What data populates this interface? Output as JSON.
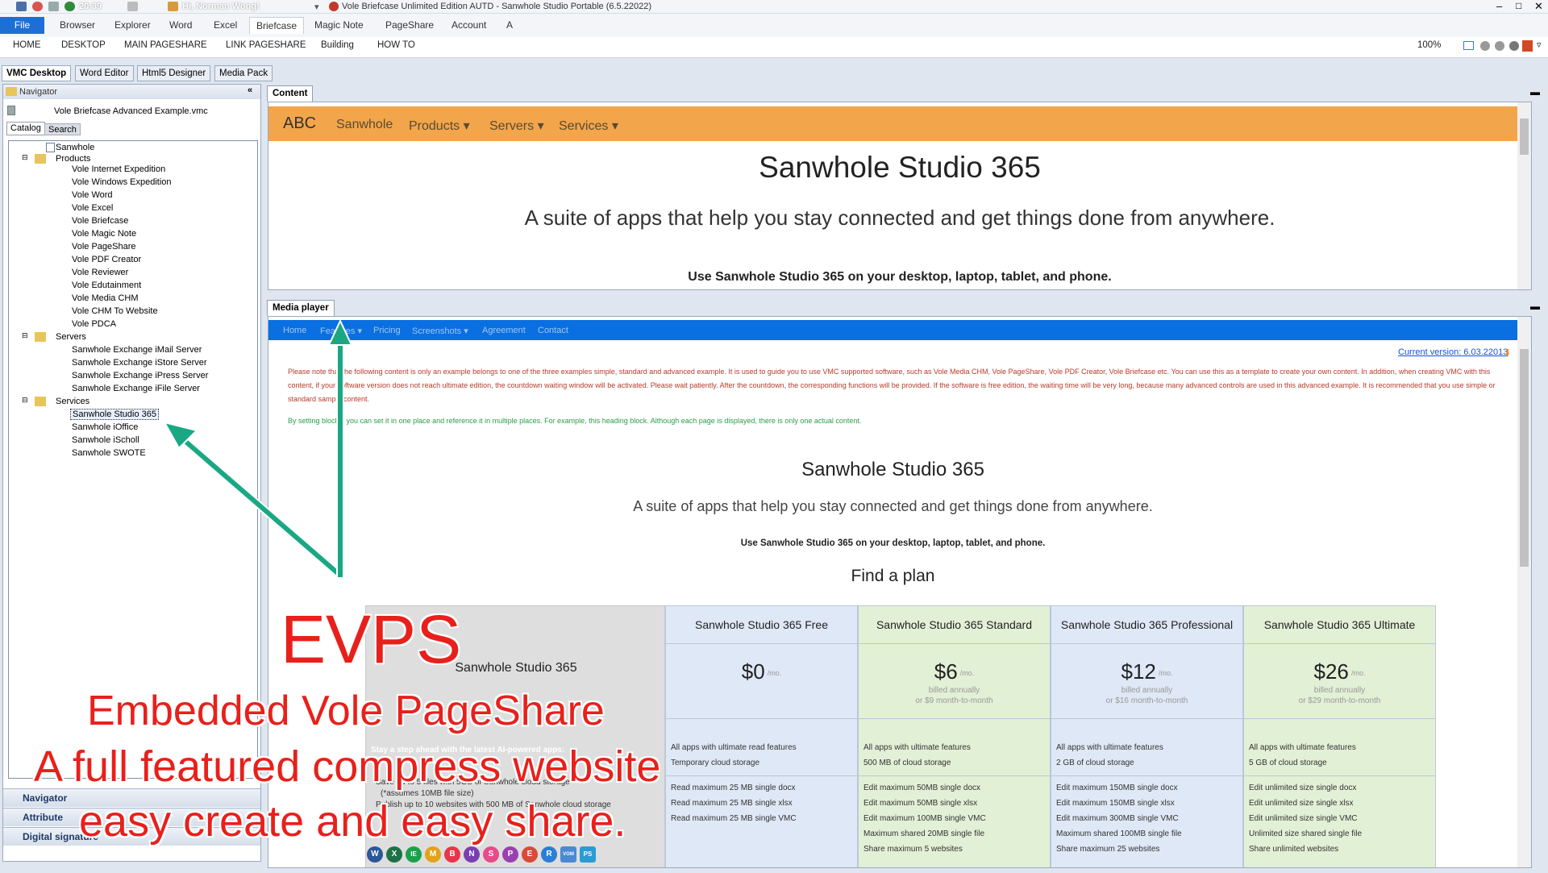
{
  "window": {
    "title": "Vole Briefcase Unlimited Edition AUTD - Sanwhole Studio Portable (6.5.22022)",
    "clock": "20:39",
    "greeting": "Hi, Norman Wong!"
  },
  "menu": [
    "File",
    "Browser",
    "Explorer",
    "Word",
    "Excel",
    "Briefcase",
    "Magic Note",
    "PageShare",
    "Account",
    "A"
  ],
  "nav": {
    "items": [
      "HOME",
      "DESKTOP",
      "MAIN PAGESHARE",
      "LINK PAGESHARE",
      "Building",
      "HOW TO"
    ],
    "zoom": "100%"
  },
  "modes": [
    "VMC Desktop",
    "Word Editor",
    "Html5 Designer",
    "Media Pack"
  ],
  "navigator": {
    "title": "Navigator",
    "file": "Vole Briefcase Advanced Example.vmc",
    "tabs": [
      "Catalog",
      "Search"
    ],
    "tree": {
      "root": "Sanwhole",
      "products_label": "Products",
      "products": [
        "Vole Internet Expedition",
        "Vole Windows Expedition",
        "Vole Word",
        "Vole Excel",
        "Vole Briefcase",
        "Vole Magic Note",
        "Vole PageShare",
        "Vole PDF Creator",
        "Vole Reviewer",
        "Vole Edutainment",
        "Vole Media CHM",
        "Vole CHM To Website",
        "Vole PDCA"
      ],
      "servers_label": "Servers",
      "servers": [
        "Sanwhole Exchange iMail Server",
        "Sanwhole Exchange iStore Server",
        "Sanwhole Exchange iPress Server",
        "Sanwhole Exchange iFile Server"
      ],
      "services_label": "Services",
      "services": [
        "Sanwhole Studio 365",
        "Sanwhole iOffice",
        "Sanwhole iScholl",
        "Sanwhole SWOTE"
      ]
    },
    "sections": [
      "Navigator",
      "Attribute",
      "Digital signature"
    ]
  },
  "content": {
    "tab": "Content",
    "site_nav": [
      "ABC",
      "Sanwhole",
      "Products",
      "Servers",
      "Services"
    ],
    "heading": "Sanwhole Studio 365",
    "subheading": "A suite of apps that help you stay connected and get things done from anywhere.",
    "tagline": "Use Sanwhole Studio 365 on your desktop, laptop, tablet, and phone."
  },
  "media": {
    "tab": "Media player",
    "nav": [
      "Home",
      "Features",
      "Pricing",
      "Screenshots",
      "Agreement",
      "Contact"
    ],
    "version": "Current version: 6.03.22013",
    "notice": "Please note that the following content is only an example belongs to one of the three examples simple, standard and advanced example. It is used to guide you to use VMC supported software, such as Vole Media CHM, Vole PageShare, Vole PDF Creator, Vole Briefcase etc. You can use this as a template to create your own content. In addition, when creating VMC with this content, if your software version does not reach ultimate edition, the countdown waiting window will be activated. Please wait patiently. After the countdown, the corresponding functions will be provided. If the software is free edition, the waiting time will be very long, because many advanced controls are used in this advanced example. It is recommended that you use simple or standard sample content.",
    "block_note": "By setting blocks, you can set it in one place and reference it in multiple places. For example, this heading block. Although each page is displayed, there is only one actual content.",
    "heading": "Sanwhole Studio 365",
    "subheading": "A suite of apps that help you stay connected and get things done from anywhere.",
    "tagline": "Use Sanwhole Studio 365 on your desktop, laptop, tablet, and phone.",
    "plan_title": "Find a plan",
    "pricing": {
      "first_col": {
        "title": "Sanwhole Studio 365",
        "lead": "Stay a step ahead with the latest AI-powered apps:",
        "items": [
          "Save up to 5 files with 5GB of Sanwhole cloud storage",
          "(*assumes 10MB file size)",
          "Publish up to 10 websites with 500 MB of Sanwhole cloud storage"
        ]
      },
      "plans": [
        {
          "name": "Sanwhole Studio 365 Free",
          "price": "$0",
          "per": "/mo.",
          "billed": "",
          "monthly": "",
          "f1": "All apps with ultimate read features",
          "f2": "Temporary cloud storage",
          "d": [
            "Read maximum 25 MB single docx",
            "Read maximum 25 MB single xlsx",
            "Read maximum 25 MB single VMC"
          ]
        },
        {
          "name": "Sanwhole Studio 365 Standard",
          "price": "$6",
          "per": "/mo.",
          "billed": "billed annually",
          "monthly": "or $9 month-to-month",
          "f1": "All apps with ultimate features",
          "f2": "500 MB of cloud storage",
          "d": [
            "Edit maximum 50MB single docx",
            "Edit maximum 50MB single xlsx",
            "Edit maximum 100MB single VMC",
            "Maximum shared 20MB single file",
            "Share maximum 5 websites"
          ]
        },
        {
          "name": "Sanwhole Studio 365 Professional",
          "price": "$12",
          "per": "/mo.",
          "billed": "billed annually",
          "monthly": "or $16 month-to-month",
          "f1": "All apps with ultimate features",
          "f2": "2 GB of cloud storage",
          "d": [
            "Edit maximum 150MB single docx",
            "Edit maximum 150MB single xlsx",
            "Edit maximum 300MB single VMC",
            "Maximum shared 100MB single file",
            "Share maximum 25 websites"
          ]
        },
        {
          "name": "Sanwhole Studio 365 Ultimate",
          "price": "$26",
          "per": "/mo.",
          "billed": "billed annually",
          "monthly": "or $29 month-to-month",
          "f1": "All apps with ultimate features",
          "f2": "5 GB of cloud storage",
          "d": [
            "Edit unlimited size single docx",
            "Edit unlimited size single xlsx",
            "Edit unlimited size single VMC",
            "Unlimited size shared single file",
            "Share unlimited websites"
          ]
        }
      ]
    }
  },
  "app_icons": [
    "W",
    "X",
    "IE",
    "M",
    "B",
    "N",
    "S",
    "P",
    "E",
    "R",
    "VOM",
    "PS"
  ],
  "overlay": {
    "big": "EVPS",
    "line1": "Embedded Vole PageShare",
    "line2": "A full featured compress website",
    "line3": "easy create and easy share."
  },
  "colors": {
    "accent": "#1e6fd4",
    "site_orange": "#f2a54a",
    "media_blue": "#0a6fe0",
    "annotation_red": "#e8201b",
    "arrow": "#1aa884"
  }
}
